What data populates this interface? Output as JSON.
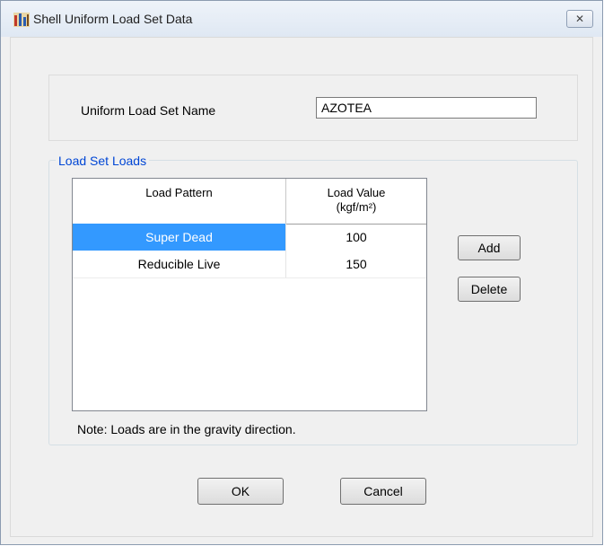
{
  "window": {
    "title": "Shell Uniform Load Set Data",
    "close_glyph": "✕"
  },
  "form": {
    "name_label": "Uniform Load Set Name",
    "name_value": "AZOTEA"
  },
  "loads_group": {
    "title": "Load Set Loads",
    "columns": {
      "pattern": "Load Pattern",
      "value_line1": "Load Value",
      "value_line2": "(kgf/m²)"
    },
    "rows": [
      {
        "pattern": "Super Dead",
        "value": "100",
        "selected": true
      },
      {
        "pattern": "Reducible Live",
        "value": "150",
        "selected": false
      }
    ],
    "add_label": "Add",
    "delete_label": "Delete",
    "note": "Note:  Loads are in the gravity direction."
  },
  "footer": {
    "ok_label": "OK",
    "cancel_label": "Cancel"
  },
  "colors": {
    "selection": "#3399ff",
    "group_title": "#0046d5"
  }
}
